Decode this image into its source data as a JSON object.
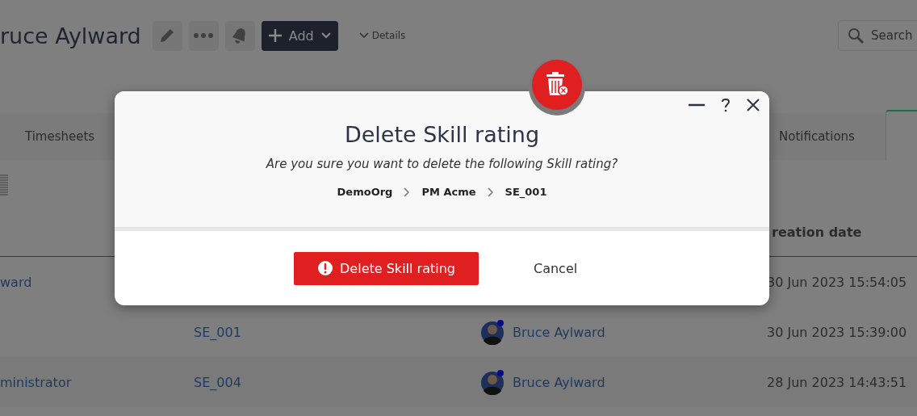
{
  "header": {
    "title": "ruce Aylward",
    "add_button": "Add",
    "details": "Details",
    "search": {
      "placeholder": "Search"
    }
  },
  "tabs": [
    {
      "label": "Timesheets",
      "selected": false
    },
    {
      "label": "Notifications",
      "selected": false
    },
    {
      "selected": true
    }
  ],
  "table": {
    "header": "reation date",
    "rows": [
      {
        "column_1": "ward",
        "created": "30 Jun 2023 15:54:05"
      },
      {
        "code": "SE_001",
        "user": "Bruce Aylward",
        "created": "30 Jun 2023 15:39:00"
      },
      {
        "column_1": "ministrator",
        "code": "SE_004",
        "user": "Bruce Aylward",
        "created": "28 Jun 2023 14:43:51"
      }
    ]
  },
  "dialog": {
    "title": "Delete Skill rating",
    "message": "Are you sure you want to delete the following Skill rating?",
    "breadcrumb": [
      "DemoOrg",
      "PM Acme",
      "SE_001"
    ],
    "confirm_button": "Delete Skill rating",
    "cancel_button": "Cancel"
  }
}
